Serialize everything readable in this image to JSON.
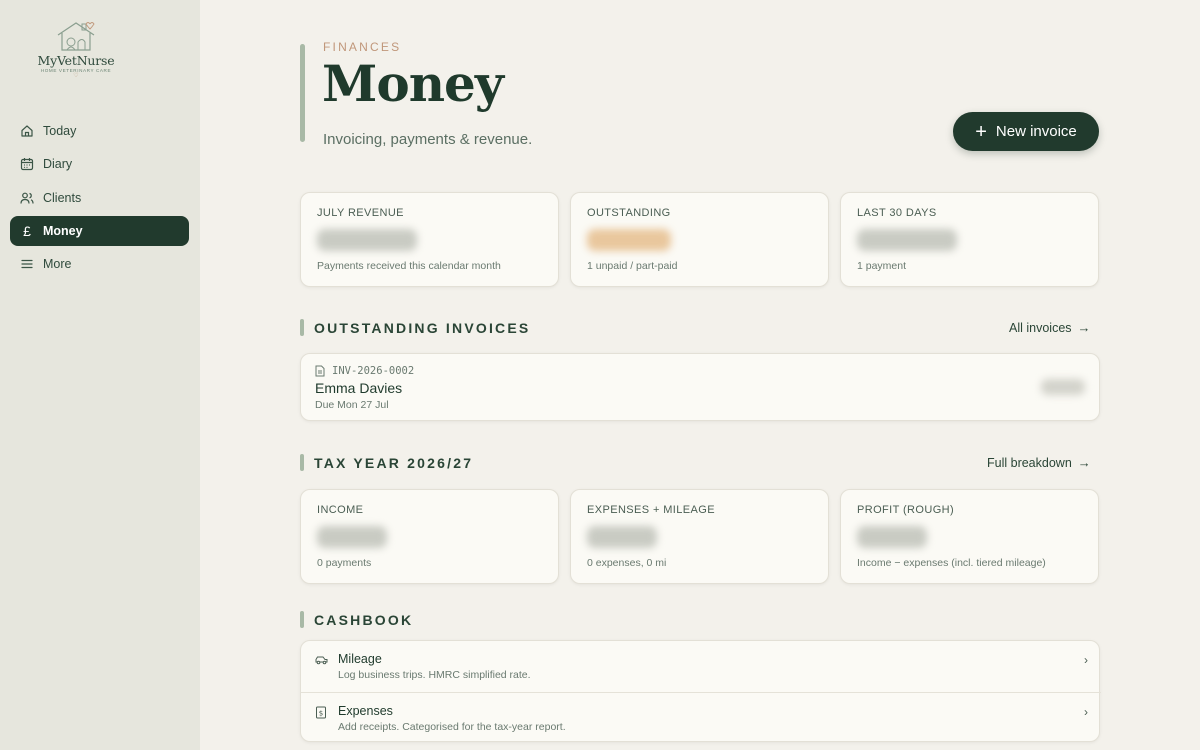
{
  "app": {
    "logo_name": "MyVetNurse",
    "logo_tagline": "HOME VETERINARY CARE"
  },
  "sidebar": {
    "items": [
      {
        "label": "Today",
        "icon": "home-icon",
        "active": false
      },
      {
        "label": "Diary",
        "icon": "calendar-icon",
        "active": false
      },
      {
        "label": "Clients",
        "icon": "users-icon",
        "active": false
      },
      {
        "label": "Money",
        "icon": "pound-icon",
        "active": true
      },
      {
        "label": "More",
        "icon": "menu-icon",
        "active": false
      }
    ]
  },
  "header": {
    "eyebrow": "FINANCES",
    "title": "Money",
    "subtitle": "Invoicing, payments & revenue.",
    "new_invoice_label": "New invoice"
  },
  "stats": [
    {
      "label": "JULY REVENUE",
      "note": "Payments received this calendar month",
      "value_style": "blurred-grey"
    },
    {
      "label": "OUTSTANDING",
      "note": "1 unpaid / part-paid",
      "value_style": "blurred-orange"
    },
    {
      "label": "LAST 30 DAYS",
      "note": "1 payment",
      "value_style": "blurred-grey"
    }
  ],
  "outstanding": {
    "heading": "OUTSTANDING INVOICES",
    "link": "All invoices",
    "invoices": [
      {
        "number": "INV-2026-0002",
        "client": "Emma Davies",
        "due": "Due Mon 27 Jul"
      }
    ]
  },
  "tax_year": {
    "heading": "TAX YEAR 2026/27",
    "link": "Full breakdown",
    "cards": [
      {
        "label": "INCOME",
        "note": "0 payments"
      },
      {
        "label": "EXPENSES + MILEAGE",
        "note": "0 expenses, 0 mi"
      },
      {
        "label": "PROFIT (ROUGH)",
        "note": "Income − expenses (incl. tiered mileage)"
      }
    ]
  },
  "cashbook": {
    "heading": "CASHBOOK",
    "rows": [
      {
        "title": "Mileage",
        "desc": "Log business trips. HMRC simplified rate.",
        "icon": "car-icon"
      },
      {
        "title": "Expenses",
        "desc": "Add receipts. Categorised for the tax-year report.",
        "icon": "receipt-icon"
      }
    ]
  },
  "colors": {
    "primary": "#213a2d",
    "accent": "#c0977a",
    "background": "#f3f1eb",
    "sidebar": "#e6e6dd"
  }
}
